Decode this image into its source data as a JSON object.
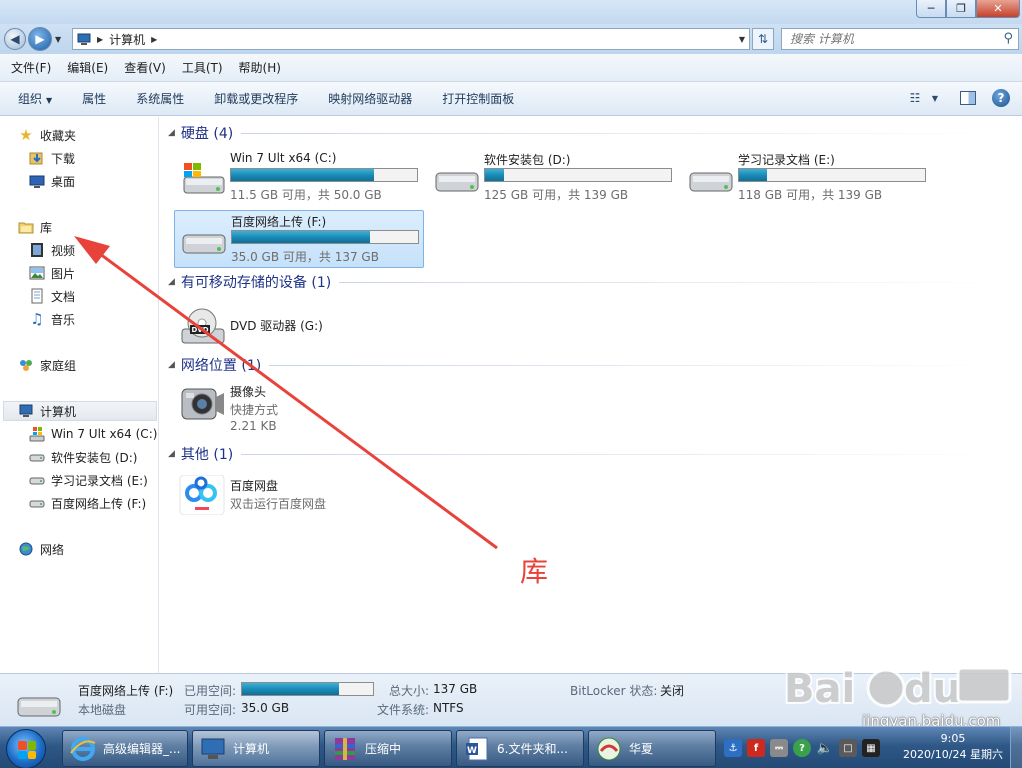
{
  "address": {
    "crumb": "计算机",
    "search_placeholder": "搜索 计算机"
  },
  "menu": [
    "文件(F)",
    "编辑(E)",
    "查看(V)",
    "工具(T)",
    "帮助(H)"
  ],
  "toolbar": {
    "organize": "组织",
    "items": [
      "属性",
      "系统属性",
      "卸载或更改程序",
      "映射网络驱动器",
      "打开控制面板"
    ]
  },
  "nav": {
    "favorites": "收藏夹",
    "downloads": "下载",
    "desktop": "桌面",
    "libraries": "库",
    "videos": "视频",
    "pictures": "图片",
    "documents": "文档",
    "music": "音乐",
    "homegroup": "家庭组",
    "computer": "计算机",
    "drive_c": "Win 7 Ult x64 (C:)",
    "drive_d": "软件安装包 (D:)",
    "drive_e": "学习记录文档 (E:)",
    "drive_f": "百度网络上传 (F:)",
    "network": "网络"
  },
  "groups": {
    "hard_disks": "硬盘 (4)",
    "removable": "有可移动存储的设备 (1)",
    "network_locations": "网络位置 (1)",
    "other": "其他 (1)"
  },
  "drives": [
    {
      "name": "Win 7 Ult x64 (C:)",
      "free": "11.5 GB 可用，共 50.0 GB",
      "used_fraction": 0.77
    },
    {
      "name": "软件安装包 (D:)",
      "free": "125 GB 可用，共 139 GB",
      "used_fraction": 0.1
    },
    {
      "name": "学习记录文档 (E:)",
      "free": "118 GB 可用，共 139 GB",
      "used_fraction": 0.15
    },
    {
      "name": "百度网络上传 (F:)",
      "free": "35.0 GB 可用，共 137 GB",
      "used_fraction": 0.74
    }
  ],
  "dvd": {
    "name": "DVD 驱动器 (G:)"
  },
  "camera": {
    "name": "摄像头",
    "type": "快捷方式",
    "size": "2.21 KB"
  },
  "baidu": {
    "name": "百度网盘",
    "desc": "双击运行百度网盘"
  },
  "annotation": "库",
  "details": {
    "name": "百度网络上传 (F:)",
    "type": "本地磁盘",
    "used_label": "已用空间:",
    "used_fraction": 0.74,
    "free_label": "可用空间:",
    "free_value": "35.0 GB",
    "total_label": "总大小:",
    "total_value": "137 GB",
    "fs_label": "文件系统:",
    "fs_value": "NTFS",
    "bitlocker_label": "BitLocker 状态:",
    "bitlocker_value": "关闭"
  },
  "watermark": {
    "text": "jingyan.baidu.com"
  },
  "taskbar": {
    "tasks": [
      "高级编辑器_...",
      "计算机",
      "压缩中",
      "6.文件夹和...",
      "华夏"
    ],
    "time": "9:05",
    "date": "2020/10/24 星期六"
  }
}
